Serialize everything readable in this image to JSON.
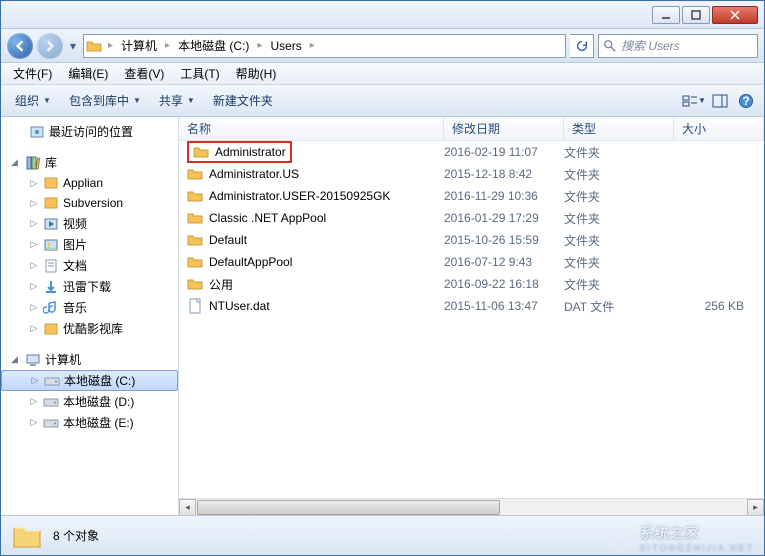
{
  "titlebar": {},
  "nav": {
    "breadcrumb": [
      {
        "label": "计算机"
      },
      {
        "label": "本地磁盘 (C:)"
      },
      {
        "label": "Users"
      }
    ],
    "search_placeholder": "搜索 Users"
  },
  "menubar": [
    {
      "label": "文件(F)"
    },
    {
      "label": "编辑(E)"
    },
    {
      "label": "查看(V)"
    },
    {
      "label": "工具(T)"
    },
    {
      "label": "帮助(H)"
    }
  ],
  "toolbar": {
    "organize": "组织",
    "include": "包含到库中",
    "share": "共享",
    "newfolder": "新建文件夹"
  },
  "tree": {
    "recent": "最近访问的位置",
    "libraries": "库",
    "lib_items": [
      "Applian",
      "Subversion",
      "视频",
      "图片",
      "文档",
      "迅雷下载",
      "音乐",
      "优酷影视库"
    ],
    "computer": "计算机",
    "drives": [
      "本地磁盘 (C:)",
      "本地磁盘 (D:)",
      "本地磁盘 (E:)"
    ]
  },
  "columns": {
    "name": "名称",
    "date": "修改日期",
    "type": "类型",
    "size": "大小"
  },
  "files": [
    {
      "name": "Administrator",
      "date": "2016-02-19 11:07",
      "type": "文件夹",
      "size": "",
      "icon": "folder",
      "highlight": true
    },
    {
      "name": "Administrator.US",
      "date": "2015-12-18 8:42",
      "type": "文件夹",
      "size": "",
      "icon": "folder"
    },
    {
      "name": "Administrator.USER-20150925GK",
      "date": "2016-11-29 10:36",
      "type": "文件夹",
      "size": "",
      "icon": "folder"
    },
    {
      "name": "Classic .NET AppPool",
      "date": "2016-01-29 17:29",
      "type": "文件夹",
      "size": "",
      "icon": "folder"
    },
    {
      "name": "Default",
      "date": "2015-10-26 15:59",
      "type": "文件夹",
      "size": "",
      "icon": "folder"
    },
    {
      "name": "DefaultAppPool",
      "date": "2016-07-12 9:43",
      "type": "文件夹",
      "size": "",
      "icon": "folder"
    },
    {
      "name": "公用",
      "date": "2016-09-22 16:18",
      "type": "文件夹",
      "size": "",
      "icon": "folder"
    },
    {
      "name": "NTUser.dat",
      "date": "2015-11-06 13:47",
      "type": "DAT 文件",
      "size": "256 KB",
      "icon": "file"
    }
  ],
  "status": {
    "count_label": "8 个对象"
  },
  "watermark": {
    "cn": "系统之家",
    "en": "XITONGZHIJIA.NET"
  }
}
